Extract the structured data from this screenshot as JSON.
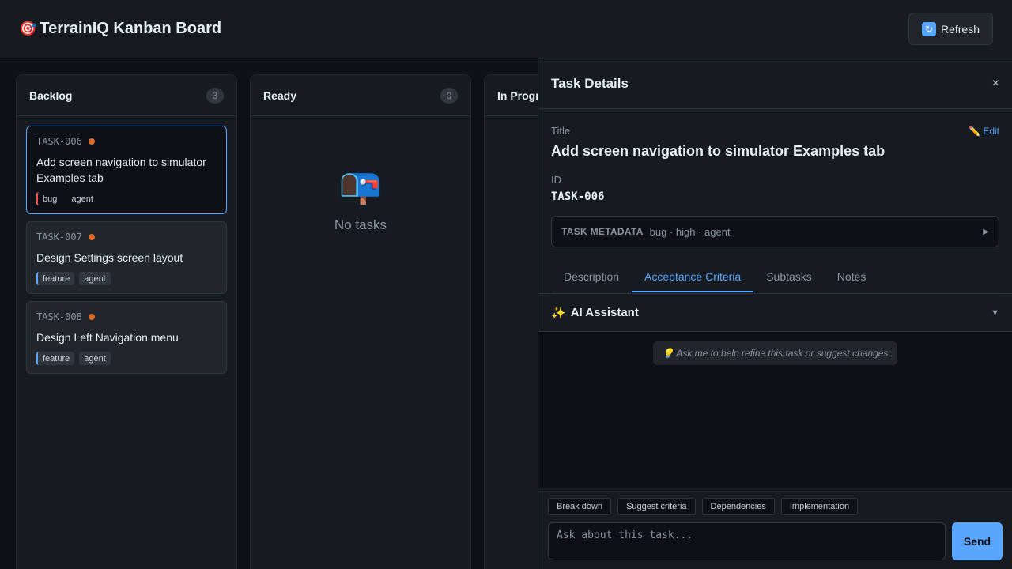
{
  "header": {
    "icon": "🎯",
    "title": "TerrainIQ Kanban Board",
    "refresh_icon": "🔄",
    "refresh_label": "Refresh"
  },
  "columns": [
    {
      "title": "Backlog",
      "count": "3",
      "cards": [
        {
          "id": "TASK-006",
          "title": "Add screen navigation to simulator Examples tab",
          "type": "bug",
          "tag2": "agent",
          "priority_color": "#db6d28"
        },
        {
          "id": "TASK-007",
          "title": "Design Settings screen layout",
          "type": "feature",
          "tag2": "agent",
          "priority_color": "#db6d28"
        },
        {
          "id": "TASK-008",
          "title": "Design Left Navigation menu",
          "type": "feature",
          "tag2": "agent",
          "priority_color": "#db6d28"
        }
      ]
    },
    {
      "title": "Ready",
      "count": "0",
      "empty_icon": "📭",
      "empty_text": "No tasks"
    },
    {
      "title": "In Progress"
    }
  ],
  "panel": {
    "title": "Task Details",
    "close_icon": "×",
    "title_label": "Title",
    "edit_label": "✏️ Edit",
    "task_title": "Add screen navigation to simulator Examples tab",
    "id_label": "ID",
    "id_value": "TASK-006",
    "meta_label": "TASK METADATA",
    "meta_value": "bug · high · agent",
    "meta_arrow": "▶",
    "tabs": [
      "Description",
      "Acceptance Criteria",
      "Subtasks",
      "Notes"
    ],
    "active_tab": "Acceptance Criteria"
  },
  "ai": {
    "icon": "✨",
    "title": "AI Assistant",
    "toggle": "▼",
    "hint": "💡 Ask me to help refine this task or suggest changes",
    "chips": [
      "Break down",
      "Suggest criteria",
      "Dependencies",
      "Implementation"
    ],
    "input_placeholder": "Ask about this task...",
    "send_label": "Send"
  },
  "colors": {
    "accent": "#58a6ff",
    "priority_high": "#db6d28",
    "bug": "#f85149",
    "background": "#0d1117"
  }
}
